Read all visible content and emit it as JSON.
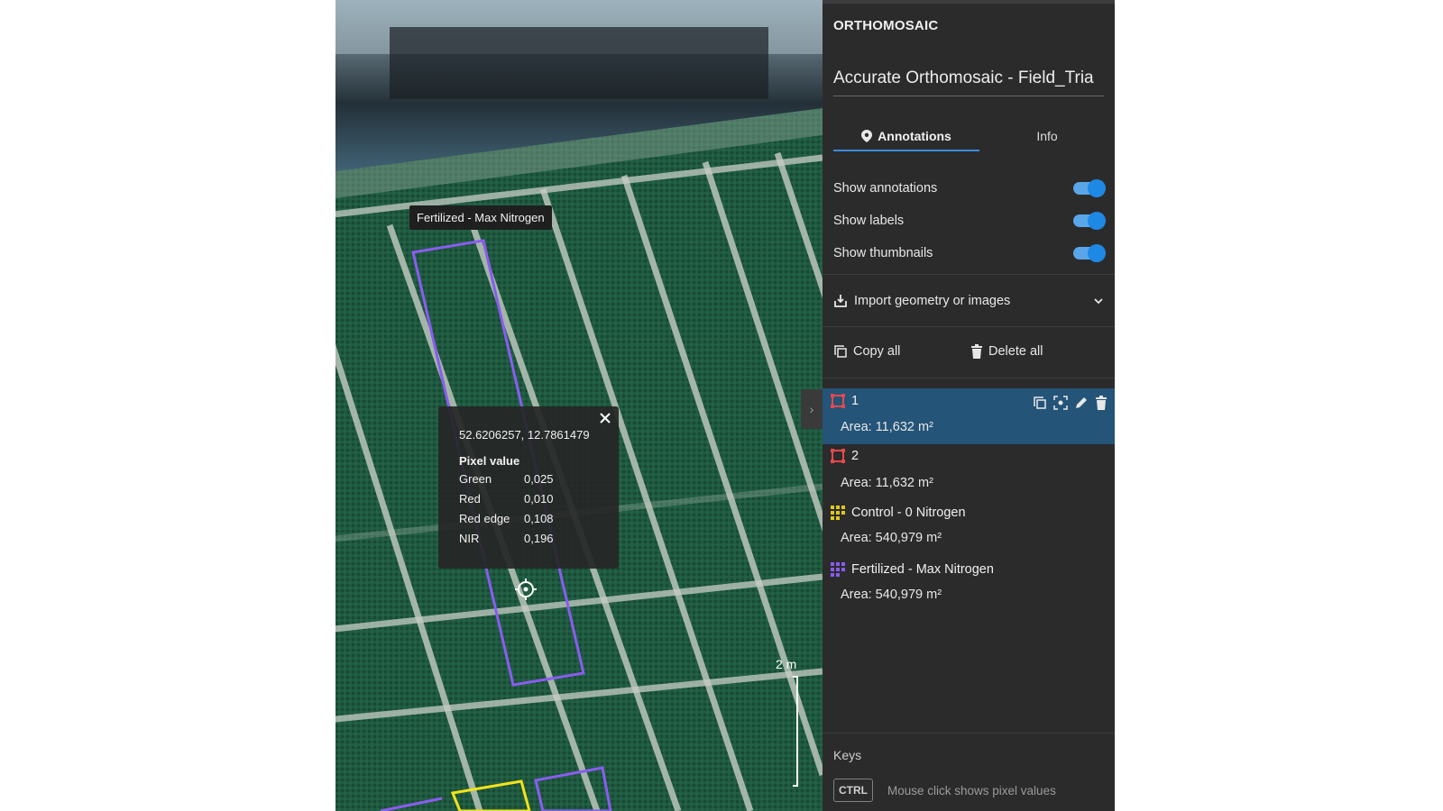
{
  "map": {
    "plot_label": "Fertilized - Max Nitrogen",
    "popup": {
      "coords": "52.6206257, 12.7861479",
      "title": "Pixel value",
      "rows": [
        {
          "band": "Green",
          "value": "0,025"
        },
        {
          "band": "Red",
          "value": "0,010"
        },
        {
          "band": "Red edge",
          "value": "0,108"
        },
        {
          "band": "NIR",
          "value": "0,196"
        }
      ]
    },
    "scale_label": "2 m",
    "colors": {
      "selected_outline": "#8a5cf0",
      "control_outline": "#f2e21a"
    }
  },
  "panel": {
    "header": "ORTHOMOSAIC",
    "title": "Accurate Orthomosaic - Field_Tria",
    "tabs": {
      "annotations": "Annotations",
      "info": "Info"
    },
    "toggles": {
      "show_annotations": {
        "label": "Show annotations",
        "on": true
      },
      "show_labels": {
        "label": "Show labels",
        "on": true
      },
      "show_thumbnails": {
        "label": "Show thumbnails",
        "on": true
      }
    },
    "import_label": "Import geometry or images",
    "copy_all": "Copy all",
    "delete_all": "Delete all",
    "annotations": [
      {
        "name": "1",
        "area": "Area: 11,632 m²",
        "icon": "polygon-icon",
        "color": "#e5484d",
        "selected": true
      },
      {
        "name": "2",
        "area": "Area: 11,632 m²",
        "icon": "polygon-icon",
        "color": "#e5484d",
        "selected": false
      },
      {
        "name": "Control - 0 Nitrogen",
        "area": "Area: 540,979 m²",
        "icon": "grid-icon",
        "color": "#e0c81a",
        "selected": false
      },
      {
        "name": "Fertilized - Max Nitrogen",
        "area": "Area: 540,979 m²",
        "icon": "grid-icon",
        "color": "#8a5cf0",
        "selected": false
      }
    ],
    "keys": {
      "title": "Keys",
      "key": "CTRL",
      "description": "Mouse click shows pixel values"
    }
  }
}
